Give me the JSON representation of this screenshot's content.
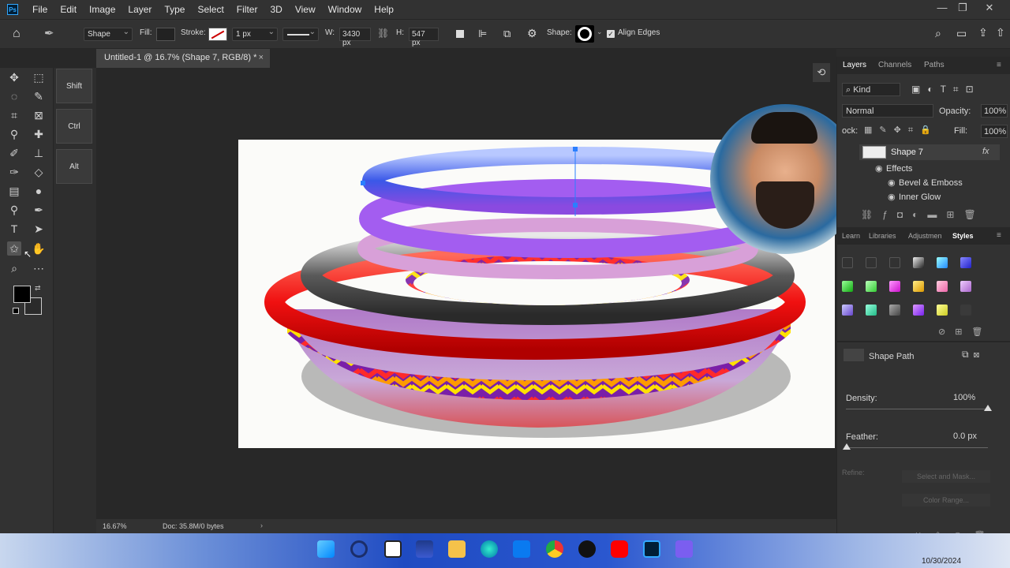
{
  "app": {
    "logo": "Ps"
  },
  "menu": [
    "File",
    "Edit",
    "Image",
    "Layer",
    "Type",
    "Select",
    "Filter",
    "3D",
    "View",
    "Window",
    "Help"
  ],
  "options": {
    "mode": "Shape",
    "fill_label": "Fill:",
    "stroke_label": "Stroke:",
    "stroke_width": "1 px",
    "w_label": "W:",
    "w_value": "3430 px",
    "h_label": "H:",
    "h_value": "547 px",
    "shape_label": "Shape:",
    "align_edges": "Align Edges"
  },
  "modifier_keys": [
    "Shift",
    "Ctrl",
    "Alt"
  ],
  "document_tab": "Untitled-1 @ 16.7% (Shape 7, RGB/8) *",
  "status": {
    "zoom": "16.67%",
    "doc": "Doc: 35.8M/0 bytes"
  },
  "layers_panel": {
    "tabs": [
      "Layers",
      "Channels",
      "Paths"
    ],
    "filter": "Kind",
    "blend": "Normal",
    "opacity_label": "Opacity:",
    "opacity": "100%",
    "lock_label": "ock:",
    "fill_label": "Fill:",
    "fill": "100%",
    "layer_name": "Shape 7",
    "fx": "fx",
    "effects": "Effects",
    "effect_items": [
      "Bevel & Emboss",
      "Inner Glow"
    ]
  },
  "styles_panel": {
    "tabs": [
      "Learn",
      "Libraries",
      "Adjustmen",
      "Styles"
    ]
  },
  "properties_panel": {
    "shape_path": "Shape Path",
    "density_label": "Density:",
    "density": "100%",
    "feather_label": "Feather:",
    "feather": "0.0 px",
    "refine": "Refine:",
    "select_mask": "Select and Mask...",
    "color_range": "Color Range..."
  },
  "taskbar": {
    "date": "10/30/2024"
  },
  "colors": {
    "accent": "#31a8ff",
    "ui_bg": "#323232",
    "canvas_bg": "#282828"
  }
}
